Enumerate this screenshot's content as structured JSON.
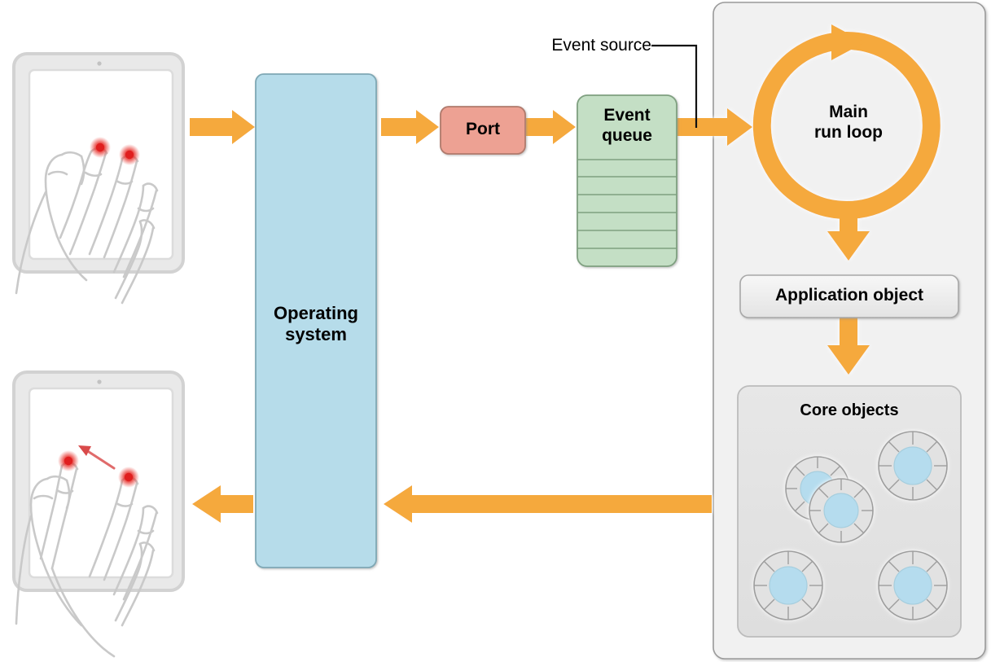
{
  "diagram": {
    "title": "Event delivery path from touch input to core objects",
    "nodes": {
      "operating_system": {
        "label": "Operating\nsystem",
        "fill": "#b6dcea",
        "stroke": "#7fa8b5"
      },
      "port": {
        "label": "Port",
        "fill": "#eda193",
        "stroke": "#b07a6c"
      },
      "event_queue": {
        "label": "Event\nqueue",
        "fill": "#c4dfc5",
        "stroke": "#7fa080",
        "rows": 6
      },
      "main_run_loop": {
        "label": "Main\nrun loop",
        "color": "#f5a93c"
      },
      "application_object": {
        "label": "Application object",
        "fill": "#eeeeee",
        "stroke": "#a8a8a8"
      },
      "core_objects": {
        "label": "Core objects",
        "fill": "#e4e4e4",
        "stroke": "#bcbcbc"
      }
    },
    "annotations": {
      "event_source": {
        "label": "Event source"
      }
    },
    "devices": [
      {
        "name": "tablet-touch-down",
        "touch_points": 2,
        "gesture": "two-finger touch"
      },
      {
        "name": "tablet-swipe",
        "touch_points": 2,
        "gesture": "two-finger swipe up-left"
      }
    ],
    "colors": {
      "arrow_orange": "#f5a93c",
      "panel_gray": "#f1f1f1",
      "panel_border": "#9a9a9a",
      "tablet_body": "#e9e9e9",
      "tablet_outline": "#d2d2d2",
      "screen_white": "#ffffff",
      "touch_red": "#e02b2b",
      "core_inner_blue": "#b5dcee",
      "core_outer_gray": "#e2e2e2",
      "hand_outline": "#c9c9c9"
    },
    "core_object_count": 4,
    "flow": [
      "tablet touch -> operating system",
      "operating system -> port",
      "port -> event queue",
      "event queue -> main run loop",
      "main run loop -> application object",
      "application object -> core objects",
      "core objects -> operating system -> tablet"
    ]
  }
}
